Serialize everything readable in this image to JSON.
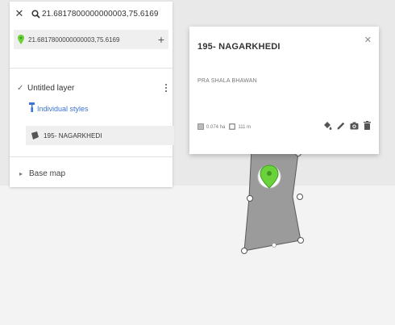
{
  "search": {
    "query": "21.6817800000000003,75.6169",
    "result": "21.6817800000000003,75.6169"
  },
  "layer": {
    "title": "Untitled layer",
    "styles_label": "Individual styles",
    "feature_label": "195- NAGARKHEDI",
    "checked": true
  },
  "basemap": {
    "label": "Base map"
  },
  "popup": {
    "title": "195- NAGARKHEDI",
    "description": "PRA SHALA BHAWAN",
    "area": "0.074 ha",
    "perimeter": "111 m"
  },
  "icons": {
    "close": "close-icon",
    "search": "search-icon",
    "pin": "map-pin-icon",
    "add": "plus-icon",
    "menu": "more-vert-icon",
    "style": "paint-roller-icon",
    "polygon": "polygon-icon",
    "expand": "chevron-right-icon",
    "fill": "paint-bucket-icon",
    "edit": "pencil-icon",
    "camera": "camera-icon",
    "delete": "trash-icon"
  },
  "colors": {
    "pin_green": "#6bd23b",
    "polygon_fill": "#9b9b9b",
    "link_blue": "#3b73d6"
  }
}
